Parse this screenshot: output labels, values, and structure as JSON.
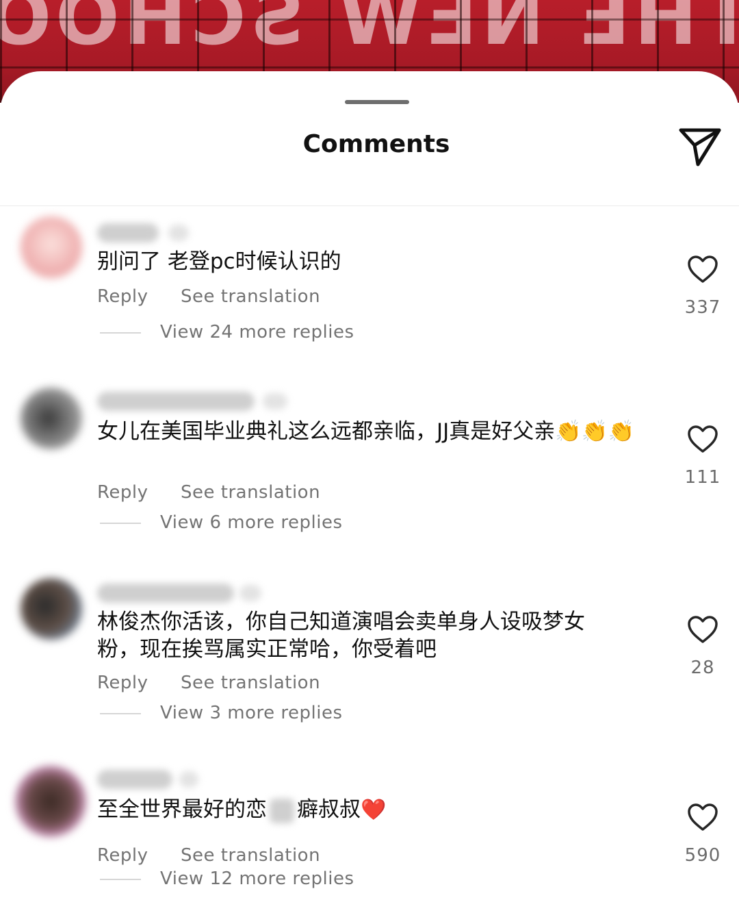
{
  "sheet": {
    "title": "Comments",
    "share_icon": "paper-plane-icon"
  },
  "comments": [
    {
      "text": "别问了 老登pc时候认识的",
      "reply_label": "Reply",
      "translate_label": "See translation",
      "view_replies": "View 24 more replies",
      "likes": "337",
      "avatar_color": "#f3c1c1"
    },
    {
      "text": "女儿在美国毕业典礼这么远都亲临，JJ真是好父亲👏👏👏",
      "reply_label": "Reply",
      "translate_label": "See translation",
      "view_replies": "View 6 more replies",
      "likes": "111",
      "avatar_color": "#8e8e8e"
    },
    {
      "text": "林俊杰你活该，你自己知道演唱会卖单身人设吸梦女粉，现在挨骂属实正常哈，你受着吧",
      "reply_label": "Reply",
      "translate_label": "See translation",
      "view_replies": "View 3 more replies",
      "likes": "28",
      "avatar_color": "#5a6b7a"
    },
    {
      "text_before": "至全世界最好的恋",
      "text_after": "癖叔叔",
      "emoji": "❤️",
      "reply_label": "Reply",
      "translate_label": "See translation",
      "view_replies": "View 12 more replies",
      "likes": "590",
      "avatar_color": "#6a4a4a"
    }
  ],
  "colors": {
    "accent_text": "#111111",
    "secondary_text": "#737373",
    "banner_red": "#b81e2a"
  }
}
